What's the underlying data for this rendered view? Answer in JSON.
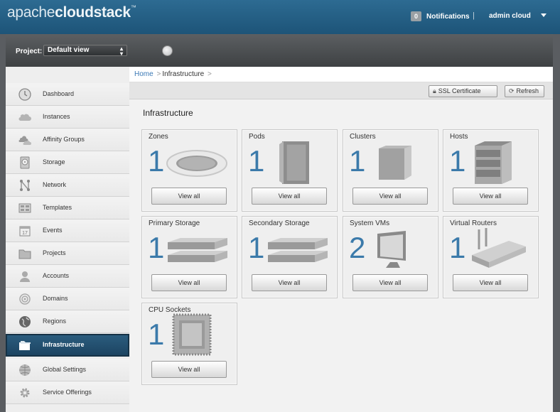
{
  "header": {
    "logo_light": "apache",
    "logo_bold": "cloudstack",
    "logo_tm": "™",
    "notification_count": "0",
    "notifications_label": "Notifications",
    "separator": "|",
    "user": "admin cloud"
  },
  "project": {
    "label": "Project:",
    "selected": "Default view"
  },
  "sidebar": {
    "items": [
      {
        "label": "Dashboard",
        "icon": "clock-icon"
      },
      {
        "label": "Instances",
        "icon": "cloud-icon"
      },
      {
        "label": "Affinity Groups",
        "icon": "cloud-cluster-icon"
      },
      {
        "label": "Storage",
        "icon": "disk-icon"
      },
      {
        "label": "Network",
        "icon": "network-icon"
      },
      {
        "label": "Templates",
        "icon": "templates-icon"
      },
      {
        "label": "Events",
        "icon": "calendar-icon"
      },
      {
        "label": "Projects",
        "icon": "folder-icon"
      },
      {
        "label": "Accounts",
        "icon": "user-icon"
      },
      {
        "label": "Domains",
        "icon": "target-icon"
      },
      {
        "label": "Regions",
        "icon": "globe-icon"
      },
      {
        "label": "Infrastructure",
        "icon": "folders-icon"
      },
      {
        "label": "Global Settings",
        "icon": "globe-grid-icon"
      },
      {
        "label": "Service Offerings",
        "icon": "gear-icon"
      }
    ],
    "active": "Infrastructure"
  },
  "breadcrumb": {
    "home": "Home",
    "sep": ">",
    "current": "Infrastructure",
    "trail": ">"
  },
  "toolbar": {
    "ssl_label": "SSL Certificate",
    "refresh_label": "Refresh"
  },
  "main": {
    "title": "Infrastructure",
    "view_all_label": "View all",
    "cards": [
      {
        "title": "Zones",
        "count": "1",
        "icon": "zone-disc-icon"
      },
      {
        "title": "Pods",
        "count": "1",
        "icon": "pod-rack-icon"
      },
      {
        "title": "Clusters",
        "count": "1",
        "icon": "cluster-box-icon"
      },
      {
        "title": "Hosts",
        "count": "1",
        "icon": "host-servers-icon"
      },
      {
        "title": "Primary Storage",
        "count": "1",
        "icon": "primary-storage-icon"
      },
      {
        "title": "Secondary Storage",
        "count": "1",
        "icon": "secondary-storage-icon"
      },
      {
        "title": "System VMs",
        "count": "2",
        "icon": "monitor-icon"
      },
      {
        "title": "Virtual Routers",
        "count": "1",
        "icon": "router-icon"
      },
      {
        "title": "CPU Sockets",
        "count": "1",
        "icon": "cpu-chip-icon"
      }
    ]
  },
  "colors": {
    "header_blue": "#2d6b92",
    "count_blue": "#3b7aaa",
    "active_nav": "#1c4461"
  }
}
